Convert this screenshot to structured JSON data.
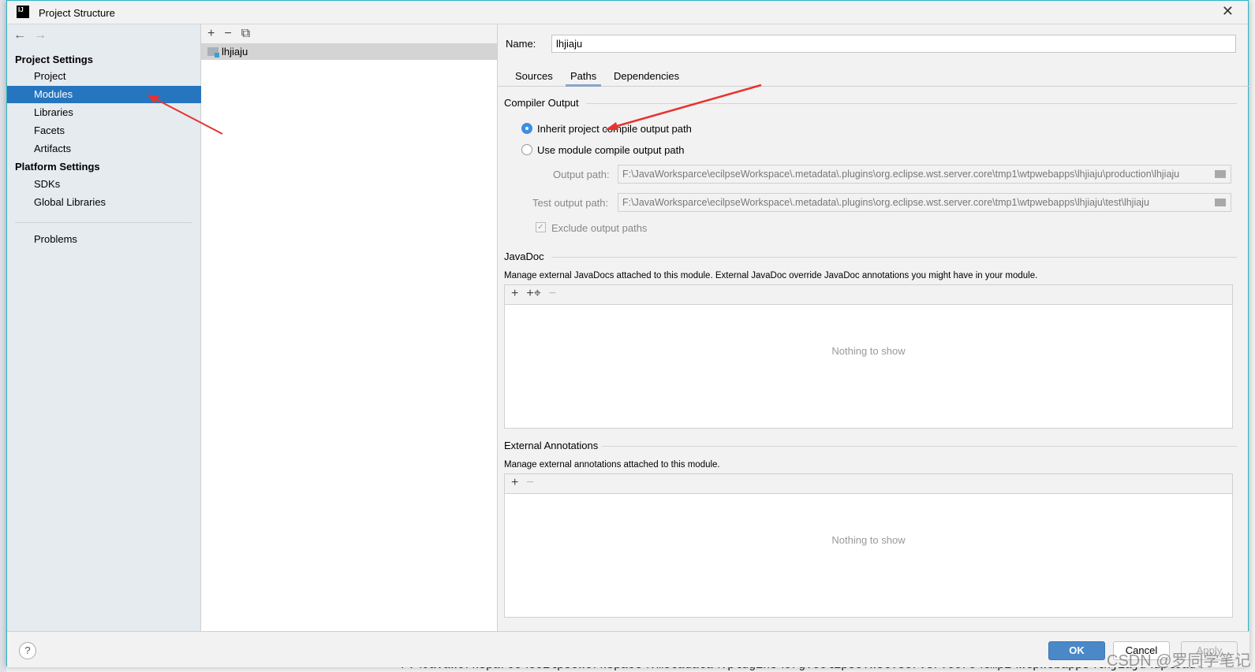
{
  "window": {
    "title": "Project Structure",
    "app_icon": "IJ"
  },
  "sidebar": {
    "project_settings": "Project Settings",
    "items": [
      {
        "label": "Project"
      },
      {
        "label": "Modules",
        "selected": true
      },
      {
        "label": "Libraries"
      },
      {
        "label": "Facets"
      },
      {
        "label": "Artifacts"
      }
    ],
    "platform_settings": "Platform Settings",
    "platform_items": [
      {
        "label": "SDKs"
      },
      {
        "label": "Global Libraries"
      }
    ],
    "problems": "Problems"
  },
  "modules": {
    "items": [
      {
        "label": "lhjiaju"
      }
    ]
  },
  "detail": {
    "name_label": "Name:",
    "name_value": "lhjiaju",
    "tabs": [
      {
        "label": "Sources"
      },
      {
        "label": "Paths",
        "active": true
      },
      {
        "label": "Dependencies"
      }
    ],
    "compiler_output": {
      "title": "Compiler Output",
      "inherit": "Inherit project compile output path",
      "use_module": "Use module compile output path",
      "selected": "inherit",
      "output_label": "Output path:",
      "output_value": "F:\\JavaWorksparce\\ecilpseWorkspace\\.metadata\\.plugins\\org.eclipse.wst.server.core\\tmp1\\wtpwebapps\\lhjiaju\\production\\lhjiaju",
      "test_label": "Test output path:",
      "test_value": "F:\\JavaWorksparce\\ecilpseWorkspace\\.metadata\\.plugins\\org.eclipse.wst.server.core\\tmp1\\wtpwebapps\\lhjiaju\\test\\lhjiaju",
      "exclude_label": "Exclude output paths",
      "exclude_checked": true
    },
    "javadoc": {
      "title": "JavaDoc",
      "desc": "Manage external JavaDocs attached to this module. External JavaDoc override JavaDoc annotations you might have in your module.",
      "empty": "Nothing to show"
    },
    "annotations": {
      "title": "External Annotations",
      "desc": "Manage external annotations attached to this module.",
      "empty": "Nothing to show"
    }
  },
  "footer": {
    "help": "?",
    "ok": "OK",
    "cancel": "Cancel",
    "apply": "Apply"
  },
  "background": {
    "console_line": "F:\\JavaWorksparce\\ecilpseWorkspace\\.metadata\\.plugins\\org.eclipse.wst.server.core\\tmp1\\wtpwebapps\\lhjiaju\\upload\\"
  },
  "watermark": "CSDN @罗同学笔记",
  "colors": {
    "selection": "#2675bf",
    "ok_button": "#4a88c8",
    "annotation_arrow": "#e8322f"
  }
}
